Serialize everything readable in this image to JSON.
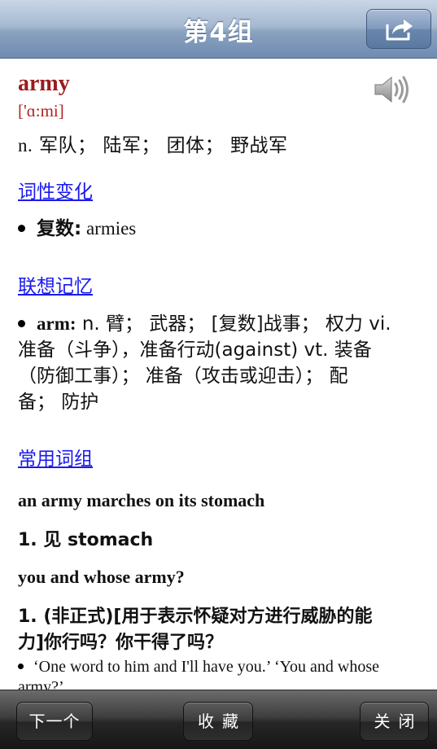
{
  "navbar": {
    "title": "第4组",
    "share_icon": "share-arrow-icon"
  },
  "entry": {
    "word": "army",
    "phonetic": "['ɑ:mi]",
    "speaker_icon": "speaker-icon",
    "definition_prefix": "n.",
    "definition_text": " 军队；  陆军；  团体；  野战军"
  },
  "sections": {
    "inflection": {
      "title": "词性变化",
      "items": [
        {
          "term": "复数:",
          "text": " armies"
        }
      ]
    },
    "association": {
      "title": "联想记忆",
      "items": [
        {
          "term": "arm:",
          "lines": [
            " n. 臂；  武器；  [复数]战事；  权力 vi.",
            "准备（斗争），准备行动(against) vt. 装备",
            "（防御工事）；  准备（攻击或迎击）；  配",
            "备；  防护"
          ]
        }
      ]
    },
    "phrases": {
      "title": "常用词组",
      "items": [
        {
          "phrase": "an army marches on its stomach",
          "meaning": "1. 见 stomach"
        },
        {
          "phrase": "you and whose army?",
          "meaning_lines": [
            "1. (非正式)[用于表示怀疑对方进行威胁的能",
            "力]你行吗？你干得了吗？"
          ],
          "example_lines": [
            "‘One word to him and I'll have you.’ ‘You and whose",
            "army?’"
          ]
        }
      ]
    }
  },
  "toolbar": {
    "next_label": "下一个",
    "favorite_label": "收藏",
    "close_label": "关闭"
  }
}
